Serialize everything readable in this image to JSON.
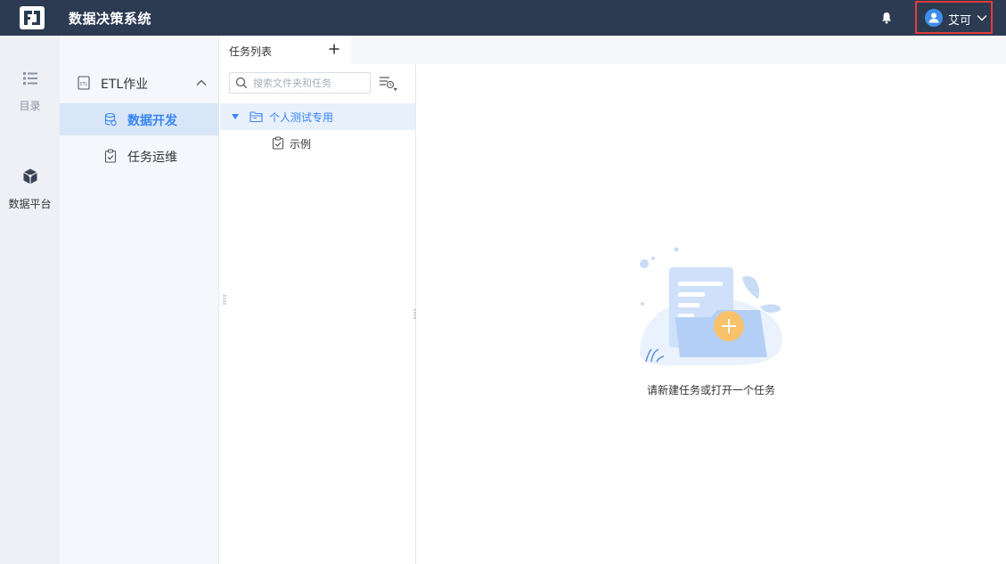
{
  "topbar": {
    "app_title": "数据决策系统",
    "user_name": "艾可",
    "bg_color": "#2c3a52",
    "icons": [
      "logo",
      "bell-icon",
      "user-avatar-icon",
      "chevron-down-icon"
    ]
  },
  "rail": {
    "items": [
      {
        "label": "目录",
        "icon": "list-icon"
      },
      {
        "label": "数据平台",
        "icon": "cube-icon"
      }
    ]
  },
  "modnav": {
    "group_label": "ETL作业",
    "items": [
      {
        "label": "数据开发",
        "icon": "database-icon",
        "active": true
      },
      {
        "label": "任务运维",
        "icon": "clipboard-icon",
        "active": false
      }
    ],
    "accent_color": "#3685f2"
  },
  "tasklist": {
    "tab_label": "任务列表",
    "search_placeholder": "搜索文件夹和任务",
    "tree": {
      "folder": "个人测试专用",
      "tasks": [
        "示例"
      ]
    }
  },
  "main": {
    "empty_text": "请新建任务或打开一个任务"
  }
}
